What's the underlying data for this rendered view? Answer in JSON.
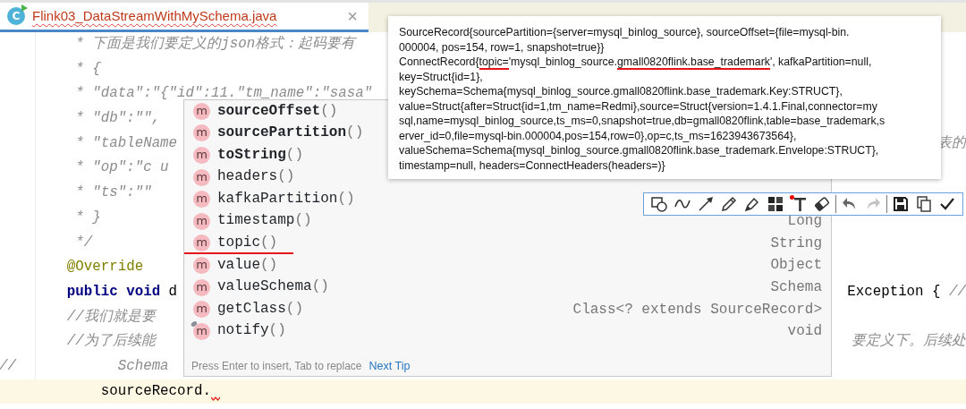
{
  "tab": {
    "icon_letter": "C",
    "label": "Flink03_DataStreamWithMySchema.java",
    "selected": true,
    "has_error": true,
    "close": "×"
  },
  "editor": {
    "lines": [
      {
        "kind": "comment",
        "text": "         * 下面是我们要定义的json格式：起码要有"
      },
      {
        "kind": "comment",
        "text": "         * {"
      },
      {
        "kind": "comment",
        "text": "         * \"data\":\"{\"id\":11.\"tm_name\":\"sasa\""
      },
      {
        "kind": "comment",
        "text": "         * \"db\":\"\", "
      },
      {
        "kind": "comment",
        "text": "         * \"tableName",
        "right": {
          "kind": "comment",
          "text": "表的"
        }
      },
      {
        "kind": "comment",
        "text": "         * \"op\":\"c u"
      },
      {
        "kind": "comment",
        "text": "         * \"ts\":\"\""
      },
      {
        "kind": "comment",
        "text": "         * }"
      },
      {
        "kind": "comment",
        "text": "         */"
      },
      {
        "kind": "annotation",
        "text": "        @Override"
      },
      {
        "kind": "code",
        "text": "        **public** **void** d",
        "right": {
          "kind": "code",
          "text": "Exception { *//*"
        }
      },
      {
        "kind": "comment",
        "text": "        //我们就是要"
      },
      {
        "kind": "comment",
        "text": "        //为了后续能",
        "right": {
          "kind": "comment",
          "text": "要定义下。后续处"
        }
      },
      {
        "kind": "comment",
        "text": "//            Schema"
      },
      {
        "kind": "code",
        "text": "            sourceRecord.",
        "current": true,
        "error": true
      }
    ]
  },
  "completion": {
    "items": [
      {
        "icon": "m",
        "name": "sourceOffset",
        "params": "()",
        "bold": true,
        "inherited": false,
        "underlined": false
      },
      {
        "icon": "m",
        "name": "sourcePartition",
        "params": "()",
        "bold": true,
        "inherited": false,
        "underlined": false
      },
      {
        "icon": "m",
        "name": "toString",
        "params": "()",
        "bold": true,
        "inherited": false,
        "underlined": false
      },
      {
        "icon": "m",
        "name": "headers",
        "params": "()",
        "bold": false,
        "inherited": false,
        "underlined": false
      },
      {
        "icon": "m",
        "name": "kafkaPartition",
        "params": "()",
        "bold": false,
        "inherited": false,
        "underlined": false
      },
      {
        "icon": "m",
        "name": "timestamp",
        "params": "()",
        "type": "Long",
        "bold": false,
        "inherited": false,
        "underlined": false
      },
      {
        "icon": "m",
        "name": "topic",
        "params": "()",
        "type": "String",
        "bold": false,
        "inherited": false,
        "underlined": true
      },
      {
        "icon": "m",
        "name": "value",
        "params": "()",
        "type": "Object",
        "bold": false,
        "inherited": false,
        "underlined": false
      },
      {
        "icon": "m",
        "name": "valueSchema",
        "params": "()",
        "type": "Schema",
        "bold": false,
        "inherited": false,
        "underlined": false
      },
      {
        "icon": "m",
        "name": "getClass",
        "params": "()",
        "type": "Class<? extends SourceRecord>",
        "bold": false,
        "inherited": false,
        "underlined": false
      },
      {
        "icon": "m",
        "name": "notify",
        "params": "()",
        "type": "void",
        "bold": false,
        "inherited": true,
        "underlined": false
      }
    ],
    "hint": "Press Enter to insert, Tab to replace",
    "link": "Next Tip"
  },
  "tooltip": {
    "lines": [
      [
        {
          "text": "SourceRecord{sourcePartition={server=mysql_binlog_source}, sourceOffset={file=mysql-bin.",
          "underlined": false
        }
      ],
      [
        {
          "text": "000004, pos=154, row=1, snapshot=true}}",
          "underlined": false
        }
      ],
      [
        {
          "text": "ConnectRecord{",
          "underlined": false
        },
        {
          "text": "topic=",
          "underlined": true
        },
        {
          "text": "'mysql_binlog_source.",
          "underlined": false
        },
        {
          "text": "gmall0820flink.base_trademark",
          "underlined": true
        },
        {
          "text": "', kafkaPartition=null,",
          "underlined": false
        }
      ],
      [
        {
          "text": "key=Struct{id=1},",
          "underlined": false
        }
      ],
      [
        {
          "text": "keySchema=Schema{mysql_binlog_source.gmall0820flink.base_trademark.Key:STRUCT},",
          "underlined": false
        }
      ],
      [
        {
          "text": "value=Struct{after=Struct{id=1,tm_name=Redmi},source=Struct{version=1.4.1.Final,connector=my",
          "underlined": false
        }
      ],
      [
        {
          "text": "sql,name=mysql_binlog_source,ts_ms=0,snapshot=true,db=gmall0820flink,table=base_trademark,s",
          "underlined": false
        }
      ],
      [
        {
          "text": "erver_id=0,file=mysql-bin.000004,pos=154,row=0},op=c,ts_ms=1623943673564},",
          "underlined": false
        }
      ],
      [
        {
          "text": "valueSchema=Schema{mysql_binlog_source.gmall0820flink.base_trademark.Envelope:STRUCT},",
          "underlined": false
        }
      ],
      [
        {
          "text": "timestamp=null, headers=ConnectHeaders(headers=)}",
          "underlined": false
        }
      ]
    ]
  },
  "toolbar": {
    "groups": [
      [
        {
          "kind": "shape",
          "disabled": false
        },
        {
          "kind": "curve",
          "disabled": false
        },
        {
          "kind": "arrow",
          "disabled": false
        },
        {
          "kind": "pencil",
          "disabled": false
        },
        {
          "kind": "marker",
          "disabled": false
        },
        {
          "kind": "mosaic",
          "disabled": false
        },
        {
          "kind": "text",
          "disabled": false
        },
        {
          "kind": "eraser",
          "disabled": false
        }
      ],
      [
        {
          "kind": "undo",
          "disabled": false
        },
        {
          "kind": "redo",
          "disabled": true
        }
      ],
      [
        {
          "kind": "save",
          "disabled": false
        },
        {
          "kind": "copy",
          "disabled": false
        },
        {
          "kind": "check",
          "disabled": false
        }
      ]
    ]
  }
}
